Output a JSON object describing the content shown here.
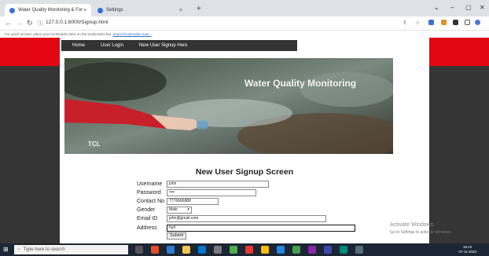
{
  "browser": {
    "tabs": [
      {
        "title": "Water Quality Monitoring & For",
        "active": true
      },
      {
        "title": "Settings",
        "active": false
      }
    ],
    "new_tab": "+",
    "url": "127.0.0.1:8000/Signup.html",
    "bookmarks_hint": "For quick access, place your bookmarks here on the bookmarks bar.",
    "bookmarks_link": "Import bookmarks now...",
    "window_controls": [
      "⌄",
      "–",
      "▢",
      "✕"
    ]
  },
  "nav": {
    "items": [
      "Home",
      "User Login",
      "New User Signup Here"
    ]
  },
  "banner": {
    "title": "Water Quality Monitoring",
    "corner_text": "TCL"
  },
  "form": {
    "heading": "New User Signup Screen",
    "fields": {
      "username": {
        "label": "Username",
        "value": "john"
      },
      "password": {
        "label": "Password",
        "value": "••••"
      },
      "contact": {
        "label": "Contact No",
        "value": "7776666888"
      },
      "gender": {
        "label": "Gender",
        "value": "Male"
      },
      "email": {
        "label": "Email ID",
        "value": "john@gmail.com"
      },
      "address": {
        "label": "Address",
        "value": "hyd"
      }
    },
    "submit_label": "Submit"
  },
  "watermark": {
    "line1": "Activate Windows",
    "line2": "Go to Settings to activate Windows."
  },
  "taskbar": {
    "search_placeholder": "Type here to search",
    "time": "16:10",
    "date": "07-11-2023"
  },
  "colors": {
    "header_red": "#e30613",
    "menu_bg": "#333333",
    "page_dark": "#353535",
    "taskbar": "#1c2533"
  }
}
